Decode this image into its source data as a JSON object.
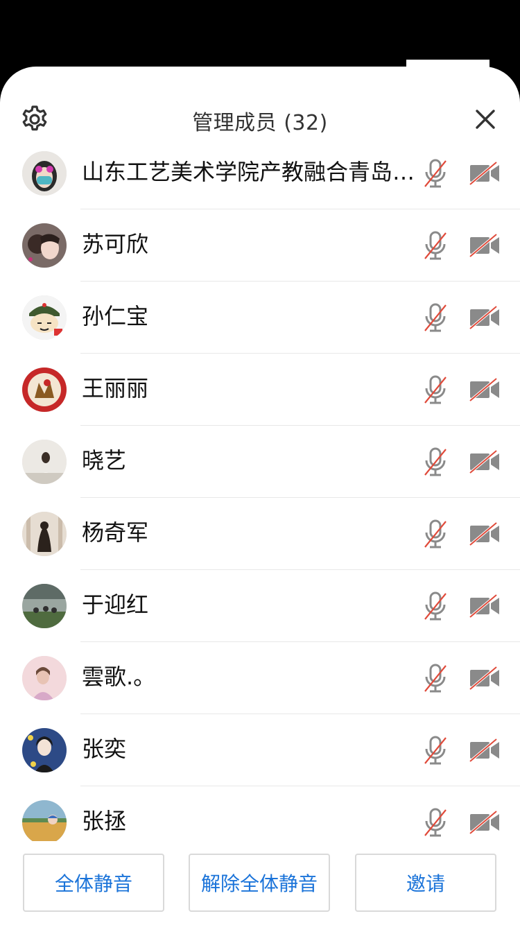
{
  "header": {
    "title": "管理成员 (32)"
  },
  "colors": {
    "accent_blue": "#1a73d9",
    "muted_red": "#e04a3a",
    "icon_gray": "#888888"
  },
  "members": [
    {
      "name": "山东工艺美术学院产教融合青岛…",
      "mic": "muted",
      "camera": "off"
    },
    {
      "name": "苏可欣",
      "mic": "muted",
      "camera": "off"
    },
    {
      "name": "孙仁宝",
      "mic": "muted",
      "camera": "off"
    },
    {
      "name": "王丽丽",
      "mic": "muted",
      "camera": "off"
    },
    {
      "name": "晓艺",
      "mic": "muted",
      "camera": "off"
    },
    {
      "name": "杨奇军",
      "mic": "muted",
      "camera": "off"
    },
    {
      "name": "于迎红",
      "mic": "muted",
      "camera": "off"
    },
    {
      "name": "雲歌.。",
      "mic": "muted",
      "camera": "off"
    },
    {
      "name": "张奕",
      "mic": "muted",
      "camera": "off"
    },
    {
      "name": "张拯",
      "mic": "muted",
      "camera": "off"
    }
  ],
  "footer": {
    "mute_all": "全体静音",
    "unmute_all": "解除全体静音",
    "invite": "邀请"
  }
}
